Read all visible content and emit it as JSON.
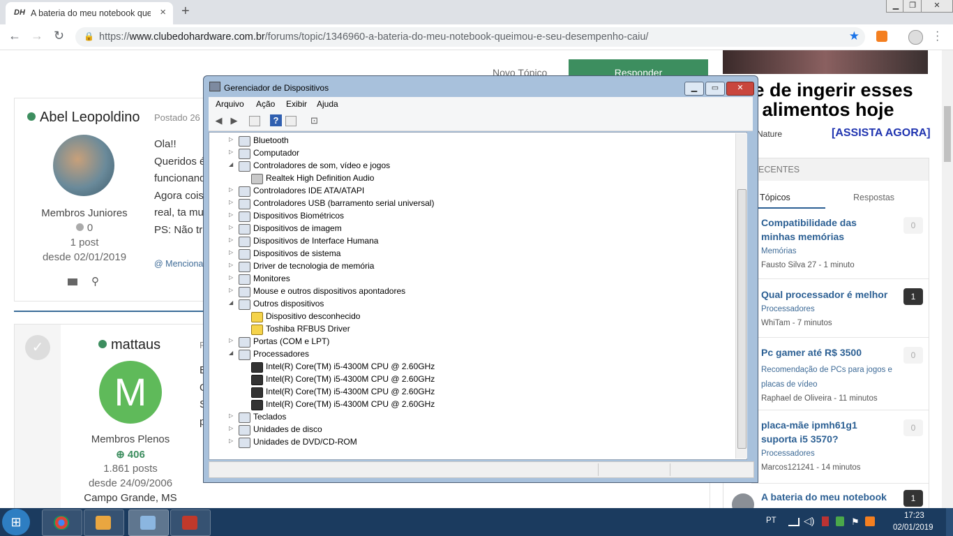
{
  "browser": {
    "tab_favicon": "DH",
    "tab_title": "A bateria do meu notebook queimou e seu desempenho caiu",
    "tab_close": "×",
    "new_tab": "+",
    "url_prefix": "https://",
    "url_host": "www.clubedohardware.com.br",
    "url_path": "/forums/topic/1346960-a-bateria-do-meu-notebook-queimou-e-seu-desempenho-caiu/",
    "back": "←",
    "forward": "→",
    "reload": "↻",
    "lock": "🔒",
    "star": "★"
  },
  "page": {
    "top_links": {
      "novo_topico": "Novo Tópico",
      "responder": "Responder"
    },
    "posts": [
      {
        "author": "Abel Leopoldino",
        "posted": "Postado 26",
        "rank": "Membros Juniores",
        "reputation": "0",
        "post_count": "1 post",
        "since": "desde 02/01/2019",
        "lines": [
          "Ola!!",
          "Queridos é",
          "funcionand",
          "Agora cois",
          "real, ta mu",
          "PS: Não tr"
        ],
        "mention": "@ Menciona"
      },
      {
        "author": "mattaus",
        "posted": "P",
        "avatar_letter": "M",
        "rank": "Membros Plenos",
        "reputation": "406",
        "post_count": "1.861 posts",
        "since": "desde 24/09/2006",
        "location": "Campo Grande, MS",
        "lines": [
          "E",
          "O",
          "S",
          "p"
        ]
      }
    ],
    "ad": {
      "line1": "re de ingerir esses",
      "line2": "3 alimentos hoje",
      "source": "Nature",
      "cta": "[ASSISTA AGORA]"
    },
    "sidebar": {
      "header": "ECENTES",
      "tabs": [
        "Tópicos",
        "Respostas"
      ],
      "topics": [
        {
          "title": "Compatibilidade das minhas memórias",
          "category": "Memórias",
          "meta": "Fausto Silva 27 - 1 minuto",
          "count": "0"
        },
        {
          "title": "Qual processador é melhor",
          "category": "Processadores",
          "meta": "WhiTam - 7 minutos",
          "count": "1"
        },
        {
          "title": "Pc gamer até R$ 3500",
          "category": "Recomendação de PCs para jogos e placas de vídeo",
          "meta": "Raphael de Oliveira - 11 minutos",
          "count": "0"
        },
        {
          "title": "placa-mãe ipmh61g1 suporta i5 3570?",
          "category": "Processadores",
          "meta": "Marcos121241 - 14 minutos",
          "count": "0"
        },
        {
          "title": "A bateria do meu notebook",
          "category": "",
          "meta": "",
          "count": "1"
        }
      ]
    }
  },
  "device_manager": {
    "title": "Gerenciador de Dispositivos",
    "menu": [
      "Arquivo",
      "Ação",
      "Exibir",
      "Ajuda"
    ],
    "tree": [
      {
        "label": "Bluetooth",
        "level": 0,
        "expanded": false
      },
      {
        "label": "Computador",
        "level": 0,
        "expanded": false
      },
      {
        "label": "Controladores de som, vídeo e jogos",
        "level": 0,
        "expanded": true
      },
      {
        "label": "Realtek High Definition Audio",
        "level": 1,
        "icon": "sound"
      },
      {
        "label": "Controladores IDE ATA/ATAPI",
        "level": 0,
        "expanded": false
      },
      {
        "label": "Controladores USB (barramento serial universal)",
        "level": 0,
        "expanded": false
      },
      {
        "label": "Dispositivos Biométricos",
        "level": 0,
        "expanded": false
      },
      {
        "label": "Dispositivos de imagem",
        "level": 0,
        "expanded": false
      },
      {
        "label": "Dispositivos de Interface Humana",
        "level": 0,
        "expanded": false
      },
      {
        "label": "Dispositivos de sistema",
        "level": 0,
        "expanded": false
      },
      {
        "label": "Driver de tecnologia de memória",
        "level": 0,
        "expanded": false
      },
      {
        "label": "Monitores",
        "level": 0,
        "expanded": false
      },
      {
        "label": "Mouse e outros dispositivos apontadores",
        "level": 0,
        "expanded": false
      },
      {
        "label": "Outros dispositivos",
        "level": 0,
        "expanded": true
      },
      {
        "label": "Dispositivo desconhecido",
        "level": 1,
        "icon": "warn"
      },
      {
        "label": "Toshiba RFBUS Driver",
        "level": 1,
        "icon": "warn"
      },
      {
        "label": "Portas (COM e LPT)",
        "level": 0,
        "expanded": false
      },
      {
        "label": "Processadores",
        "level": 0,
        "expanded": true
      },
      {
        "label": "Intel(R) Core(TM) i5-4300M CPU @ 2.60GHz",
        "level": 1,
        "icon": "cpu"
      },
      {
        "label": "Intel(R) Core(TM) i5-4300M CPU @ 2.60GHz",
        "level": 1,
        "icon": "cpu"
      },
      {
        "label": "Intel(R) Core(TM) i5-4300M CPU @ 2.60GHz",
        "level": 1,
        "icon": "cpu"
      },
      {
        "label": "Intel(R) Core(TM) i5-4300M CPU @ 2.60GHz",
        "level": 1,
        "icon": "cpu"
      },
      {
        "label": "Teclados",
        "level": 0,
        "expanded": false
      },
      {
        "label": "Unidades de disco",
        "level": 0,
        "expanded": false
      },
      {
        "label": "Unidades de DVD/CD-ROM",
        "level": 0,
        "expanded": false
      }
    ]
  },
  "taskbar": {
    "start_glyph": "⊞",
    "language": "PT",
    "time": "17:23",
    "date": "02/01/2019"
  },
  "colors": {
    "taskbar": "#1b3b5f",
    "accent_green": "#3d8e5f",
    "link_blue": "#2b5f93"
  }
}
